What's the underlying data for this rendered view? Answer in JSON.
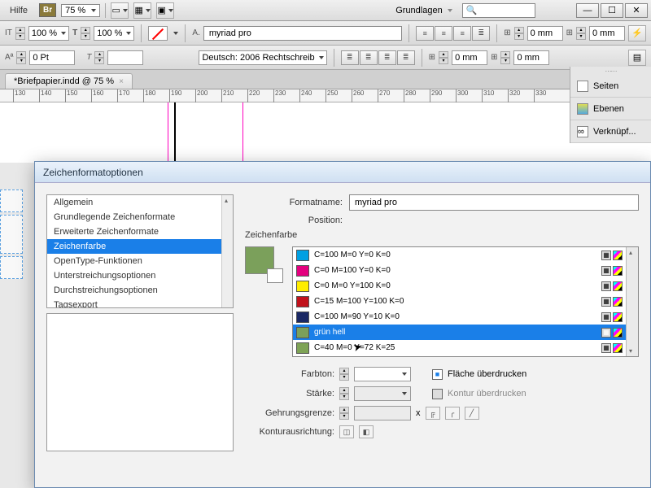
{
  "menubar": {
    "help": "Hilfe",
    "br": "Br",
    "zoom": "75 %",
    "workspace": "Grundlagen"
  },
  "toolbar1": {
    "sizeA": "100 %",
    "sizeB": "100 %",
    "font": "myriad pro",
    "lang": "Deutsch: 2006 Rechtschreib",
    "inset1": "0 mm",
    "inset2": "0 mm",
    "inset3": "0 mm",
    "inset4": "0 mm",
    "pt": "0 Pt"
  },
  "tab": {
    "title": "*Briefpapier.indd @ 75 %"
  },
  "ruler": {
    "ticks": [
      "130",
      "140",
      "150",
      "160",
      "170",
      "180",
      "190",
      "200",
      "210",
      "220",
      "230",
      "240",
      "250",
      "260",
      "270",
      "280",
      "290",
      "300",
      "310",
      "320",
      "330"
    ]
  },
  "panels": {
    "p1": "Seiten",
    "p2": "Ebenen",
    "p3": "Verknüpf..."
  },
  "dialog": {
    "title": "Zeichenformatoptionen",
    "categories": [
      "Allgemein",
      "Grundlegende Zeichenformate",
      "Erweiterte Zeichenformate",
      "Zeichenfarbe",
      "OpenType-Funktionen",
      "Unterstreichungsoptionen",
      "Durchstreichungsoptionen",
      "Tagsexport"
    ],
    "selectedCategory": 3,
    "formatnameLabel": "Formatname:",
    "formatname": "myriad pro",
    "positionLabel": "Position:",
    "sectionLabel": "Zeichenfarbe",
    "swatches": [
      {
        "name": "C=100 M=0 Y=0 K=0",
        "color": "#00a0e3"
      },
      {
        "name": "C=0 M=100 Y=0 K=0",
        "color": "#e4007f"
      },
      {
        "name": "C=0 M=0 Y=100 K=0",
        "color": "#ffed00"
      },
      {
        "name": "C=15 M=100 Y=100 K=0",
        "color": "#c1121c"
      },
      {
        "name": "C=100 M=90 Y=10 K=0",
        "color": "#1a2864"
      },
      {
        "name": "grün hell",
        "color": "#7ba05b"
      },
      {
        "name": "C=40 M=0 Y=72 K=25",
        "color": "#7ea356"
      }
    ],
    "selectedSwatch": 5,
    "farbtonLabel": "Farbton:",
    "staerkeLabel": "Stärke:",
    "gehrungLabel": "Gehrungsgrenze:",
    "gehrungX": "x",
    "konturLabel": "Konturausrichtung:",
    "chkFlaeche": "Fläche überdrucken",
    "chkKontur": "Kontur überdrucken"
  }
}
